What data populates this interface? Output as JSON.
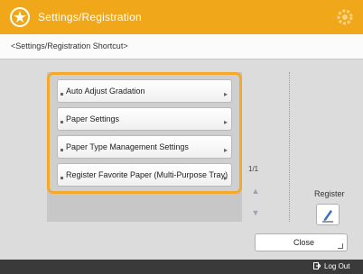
{
  "header": {
    "title": "Settings/Registration",
    "title_icon": "settings-registration-icon",
    "right_icon": "gear-icon"
  },
  "breadcrumb": "<Settings/Registration Shortcut>",
  "list": {
    "items": [
      {
        "label": "Auto Adjust Gradation"
      },
      {
        "label": "Paper Settings"
      },
      {
        "label": "Paper Type Management Settings"
      },
      {
        "label": "Register Favorite Paper (Multi-Purpose Tray)"
      }
    ],
    "page_indicator": "1/1"
  },
  "register": {
    "label": "Register",
    "icon": "pencil-icon"
  },
  "actions": {
    "close_label": "Close"
  },
  "status": {
    "logout_label": "Log Out"
  },
  "colors": {
    "title_bar": "#f0a81a",
    "highlight": "#f4a92a",
    "status_bar": "#3a3a3a"
  }
}
